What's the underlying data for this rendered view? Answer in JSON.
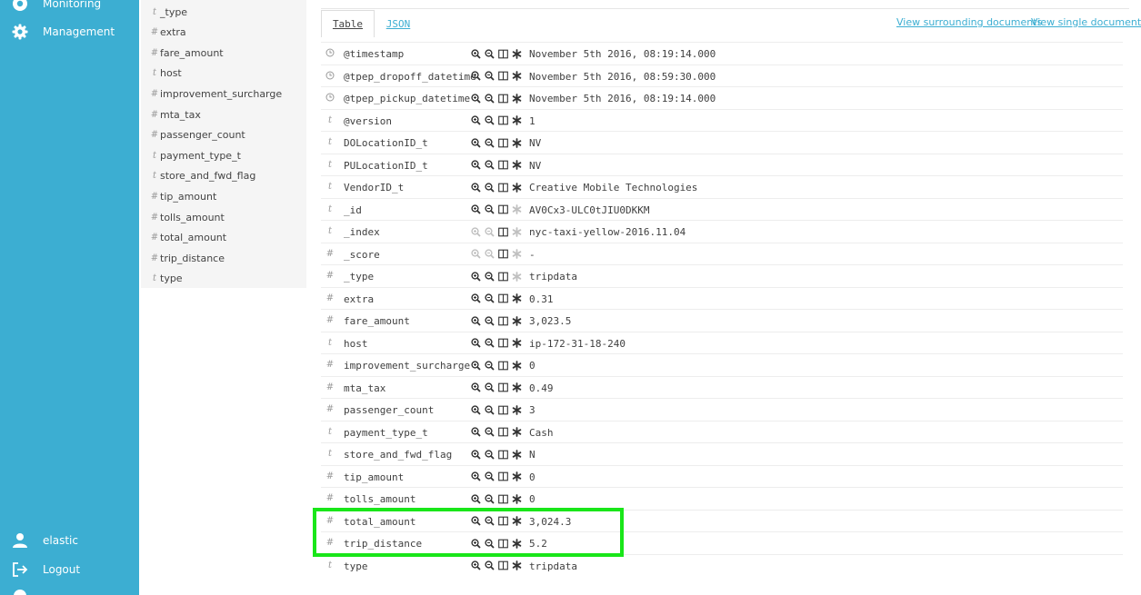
{
  "nav": {
    "monitoring_label": "Monitoring",
    "management_label": "Management",
    "user_label": "elastic",
    "logout_label": "Logout"
  },
  "fields": [
    {
      "type": "t",
      "name": "_type"
    },
    {
      "type": "#",
      "name": "extra"
    },
    {
      "type": "#",
      "name": "fare_amount"
    },
    {
      "type": "t",
      "name": "host"
    },
    {
      "type": "#",
      "name": "improvement_surcharge"
    },
    {
      "type": "#",
      "name": "mta_tax"
    },
    {
      "type": "#",
      "name": "passenger_count"
    },
    {
      "type": "t",
      "name": "payment_type_t"
    },
    {
      "type": "t",
      "name": "store_and_fwd_flag"
    },
    {
      "type": "#",
      "name": "tip_amount"
    },
    {
      "type": "#",
      "name": "tolls_amount"
    },
    {
      "type": "#",
      "name": "total_amount"
    },
    {
      "type": "#",
      "name": "trip_distance"
    },
    {
      "type": "t",
      "name": "type"
    }
  ],
  "doc": {
    "tab_table": "Table",
    "tab_json": "JSON",
    "link_surrounding": "View surrounding documents",
    "link_single": "View single document",
    "rows": [
      {
        "type": "clock",
        "name": "@timestamp",
        "value": "November 5th 2016, 08:19:14.000",
        "dim": false
      },
      {
        "type": "clock",
        "name": "@tpep_dropoff_datetime",
        "value": "November 5th 2016, 08:59:30.000",
        "dim": false
      },
      {
        "type": "clock",
        "name": "@tpep_pickup_datetime",
        "value": "November 5th 2016, 08:19:14.000",
        "dim": false
      },
      {
        "type": "t",
        "name": "@version",
        "value": "1",
        "dim": false
      },
      {
        "type": "t",
        "name": "DOLocationID_t",
        "value": "NV",
        "dim": false
      },
      {
        "type": "t",
        "name": "PULocationID_t",
        "value": "NV",
        "dim": false
      },
      {
        "type": "t",
        "name": "VendorID_t",
        "value": "Creative Mobile Technologies",
        "dim": false
      },
      {
        "type": "t",
        "name": "_id",
        "value": "AV0Cx3-ULC0tJIU0DKKM",
        "dim": "partial"
      },
      {
        "type": "t",
        "name": "_index",
        "value": "nyc-taxi-yellow-2016.11.04",
        "dim": "full"
      },
      {
        "type": "#",
        "name": "_score",
        "value": " -",
        "dim": "full"
      },
      {
        "type": "#",
        "name": "_type",
        "value": "tripdata",
        "dim": "partial"
      },
      {
        "type": "#",
        "name": "extra",
        "value": "0.31",
        "dim": false
      },
      {
        "type": "#",
        "name": "fare_amount",
        "value": "3,023.5",
        "dim": false
      },
      {
        "type": "t",
        "name": "host",
        "value": "ip-172-31-18-240",
        "dim": false
      },
      {
        "type": "#",
        "name": "improvement_surcharge",
        "value": "0",
        "dim": false
      },
      {
        "type": "#",
        "name": "mta_tax",
        "value": "0.49",
        "dim": false
      },
      {
        "type": "#",
        "name": "passenger_count",
        "value": "3",
        "dim": false
      },
      {
        "type": "t",
        "name": "payment_type_t",
        "value": "Cash",
        "dim": false
      },
      {
        "type": "t",
        "name": "store_and_fwd_flag",
        "value": "N",
        "dim": false
      },
      {
        "type": "#",
        "name": "tip_amount",
        "value": "0",
        "dim": false
      },
      {
        "type": "#",
        "name": "tolls_amount",
        "value": "0",
        "dim": false
      },
      {
        "type": "#",
        "name": "total_amount",
        "value": "3,024.3",
        "dim": false
      },
      {
        "type": "#",
        "name": "trip_distance",
        "value": "5.2",
        "dim": false
      },
      {
        "type": "t",
        "name": "type",
        "value": "tripdata",
        "dim": false
      }
    ]
  },
  "colors": {
    "nav_bg": "#3caed2",
    "highlight": "#19e619",
    "link": "#3caed2"
  }
}
